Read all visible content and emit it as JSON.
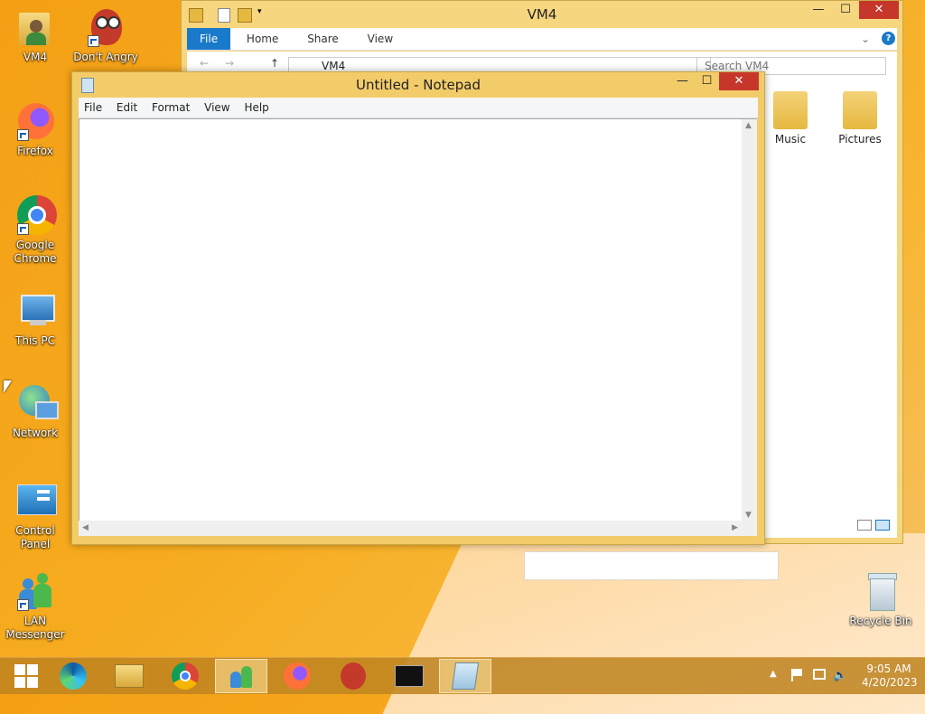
{
  "desktop": {
    "icons": [
      {
        "label": "VM4"
      },
      {
        "label": "Don't Angry"
      },
      {
        "label": "Firefox"
      },
      {
        "label": "Google Chrome"
      },
      {
        "label": "This PC"
      },
      {
        "label": "Network"
      },
      {
        "label": "Control Panel"
      },
      {
        "label": "LAN Messenger"
      },
      {
        "label": "Recycle Bin"
      }
    ]
  },
  "explorer": {
    "title": "VM4",
    "ribbon_tabs": [
      "File",
      "Home",
      "Share",
      "View"
    ],
    "path": "VM4",
    "search_placeholder": "Search VM4",
    "folders": [
      {
        "label": "Music"
      },
      {
        "label": "Pictures"
      }
    ]
  },
  "notepad": {
    "title": "Untitled - Notepad",
    "menu": [
      "File",
      "Edit",
      "Format",
      "View",
      "Help"
    ],
    "content": ""
  },
  "taskbar": {
    "time": "9:05 AM",
    "date": "4/20/2023"
  },
  "colors": {
    "accent": "#1979ca",
    "close": "#c7362b"
  }
}
